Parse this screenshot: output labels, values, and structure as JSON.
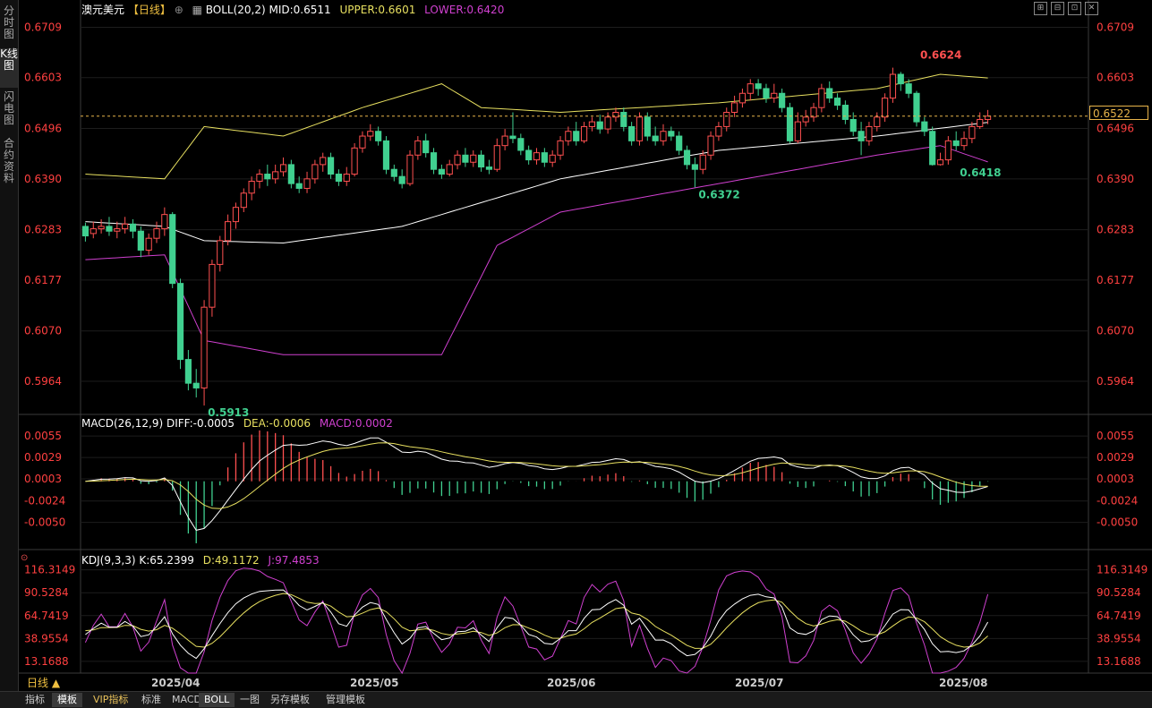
{
  "sidebar": {
    "items": [
      {
        "label": "分时图",
        "active": false
      },
      {
        "label": "K线图",
        "active": true
      },
      {
        "label": "闪电图",
        "active": false
      },
      {
        "label": "合约资料",
        "active": false
      }
    ]
  },
  "main_header": {
    "symbol": "澳元美元",
    "period": "【日线】",
    "boll_label": "BOLL(20,2)",
    "mid": "MID:0.6511",
    "upper": "UPPER:0.6601",
    "lower": "LOWER:0.6420"
  },
  "window_buttons": [
    "⊞",
    "⊟",
    "⊡",
    "✕"
  ],
  "price_axis_ticks": [
    "0.6709",
    "0.6603",
    "0.6496",
    "0.6390",
    "0.6283",
    "0.6177",
    "0.6070",
    "0.5964"
  ],
  "current_price": "0.6522",
  "annotations": {
    "high": "0.6624",
    "low": "0.5913",
    "mid_low": "0.6372",
    "recent_low": "0.6418"
  },
  "macd_header": {
    "label": "MACD(26,12,9)",
    "diff": "DIFF:-0.0005",
    "dea": "DEA:-0.0006",
    "macd": "MACD:0.0002"
  },
  "macd_ticks": [
    "0.0055",
    "0.0029",
    "0.0003",
    "-0.0024",
    "-0.0050"
  ],
  "kdj_header": {
    "label": "KDJ(9,3,3)",
    "k": "K:65.2399",
    "d": "D:49.1172",
    "j": "J:97.4853"
  },
  "kdj_ticks": [
    "116.3149",
    "90.5284",
    "64.7419",
    "38.9554",
    "13.1688"
  ],
  "date_labels": [
    "2025/04",
    "2025/05",
    "2025/06",
    "2025/07",
    "2025/08"
  ],
  "period_button": "日线 ▲",
  "bottom_tabs": [
    {
      "label": "指标",
      "active": false,
      "vip": false
    },
    {
      "label": "模板",
      "active": true,
      "vip": false
    },
    {
      "label": "VIP指标",
      "active": false,
      "vip": true
    },
    {
      "label": "标准",
      "active": false,
      "vip": false
    },
    {
      "label": "MACD",
      "active": false,
      "vip": false
    },
    {
      "label": "BOLL",
      "active": true,
      "vip": false
    },
    {
      "label": "一图",
      "active": false,
      "vip": false
    },
    {
      "label": "另存模板",
      "active": false,
      "vip": false
    },
    {
      "label": "管理模板",
      "active": false,
      "vip": false
    }
  ],
  "colors": {
    "up": "#ff5050",
    "down": "#40d090",
    "mid": "#ffffff",
    "upper": "#e8e060",
    "lower": "#d040d0",
    "axis_text": "#ff4040",
    "grid": "#333333",
    "current": "#e8b44a"
  },
  "chart_data": {
    "type": "candlestick",
    "price_range": [
      0.59,
      0.674
    ],
    "candles": [
      [
        0.629,
        0.627,
        0.6298,
        0.6258
      ],
      [
        0.6275,
        0.6285,
        0.63,
        0.6265
      ],
      [
        0.6285,
        0.629,
        0.6305,
        0.6275
      ],
      [
        0.629,
        0.628,
        0.631,
        0.627
      ],
      [
        0.628,
        0.6285,
        0.63,
        0.6265
      ],
      [
        0.6285,
        0.6295,
        0.631,
        0.6275
      ],
      [
        0.6295,
        0.628,
        0.6305,
        0.6265
      ],
      [
        0.628,
        0.624,
        0.629,
        0.6225
      ],
      [
        0.624,
        0.6265,
        0.6275,
        0.623
      ],
      [
        0.6265,
        0.6285,
        0.63,
        0.6255
      ],
      [
        0.6285,
        0.6315,
        0.633,
        0.627
      ],
      [
        0.6315,
        0.617,
        0.632,
        0.616
      ],
      [
        0.617,
        0.601,
        0.618,
        0.599
      ],
      [
        0.601,
        0.596,
        0.603,
        0.5945
      ],
      [
        0.596,
        0.595,
        0.599,
        0.593
      ],
      [
        0.595,
        0.612,
        0.6135,
        0.5913
      ],
      [
        0.612,
        0.621,
        0.622,
        0.61
      ],
      [
        0.621,
        0.626,
        0.627,
        0.6195
      ],
      [
        0.626,
        0.63,
        0.6315,
        0.625
      ],
      [
        0.63,
        0.633,
        0.634,
        0.6285
      ],
      [
        0.633,
        0.636,
        0.637,
        0.632
      ],
      [
        0.636,
        0.6385,
        0.6395,
        0.6345
      ],
      [
        0.6385,
        0.64,
        0.641,
        0.637
      ],
      [
        0.64,
        0.639,
        0.642,
        0.6375
      ],
      [
        0.639,
        0.6405,
        0.642,
        0.638
      ],
      [
        0.6405,
        0.642,
        0.6435,
        0.6395
      ],
      [
        0.642,
        0.638,
        0.643,
        0.637
      ],
      [
        0.638,
        0.637,
        0.6395,
        0.636
      ],
      [
        0.637,
        0.639,
        0.6405,
        0.636
      ],
      [
        0.639,
        0.642,
        0.643,
        0.638
      ],
      [
        0.642,
        0.6435,
        0.6445,
        0.6405
      ],
      [
        0.6435,
        0.64,
        0.6445,
        0.639
      ],
      [
        0.64,
        0.6385,
        0.641,
        0.6375
      ],
      [
        0.6385,
        0.64,
        0.6415,
        0.6375
      ],
      [
        0.64,
        0.6455,
        0.6465,
        0.6395
      ],
      [
        0.6455,
        0.648,
        0.649,
        0.6445
      ],
      [
        0.648,
        0.649,
        0.6505,
        0.647
      ],
      [
        0.649,
        0.647,
        0.65,
        0.646
      ],
      [
        0.647,
        0.641,
        0.648,
        0.64
      ],
      [
        0.641,
        0.6395,
        0.642,
        0.6385
      ],
      [
        0.6395,
        0.638,
        0.641,
        0.637
      ],
      [
        0.638,
        0.644,
        0.645,
        0.6375
      ],
      [
        0.644,
        0.647,
        0.648,
        0.643
      ],
      [
        0.647,
        0.6445,
        0.6485,
        0.6435
      ],
      [
        0.6445,
        0.641,
        0.6455,
        0.64
      ],
      [
        0.641,
        0.64,
        0.642,
        0.639
      ],
      [
        0.64,
        0.642,
        0.643,
        0.6395
      ],
      [
        0.642,
        0.644,
        0.645,
        0.641
      ],
      [
        0.644,
        0.6425,
        0.6455,
        0.6415
      ],
      [
        0.6425,
        0.644,
        0.645,
        0.6415
      ],
      [
        0.644,
        0.6415,
        0.645,
        0.6405
      ],
      [
        0.6415,
        0.641,
        0.643,
        0.64
      ],
      [
        0.641,
        0.646,
        0.6475,
        0.6405
      ],
      [
        0.646,
        0.648,
        0.6495,
        0.645
      ],
      [
        0.648,
        0.6475,
        0.653,
        0.6465
      ],
      [
        0.6475,
        0.645,
        0.6485,
        0.644
      ],
      [
        0.645,
        0.643,
        0.646,
        0.642
      ],
      [
        0.643,
        0.6445,
        0.6455,
        0.642
      ],
      [
        0.6445,
        0.6425,
        0.6455,
        0.6415
      ],
      [
        0.6425,
        0.644,
        0.645,
        0.6415
      ],
      [
        0.644,
        0.647,
        0.648,
        0.643
      ],
      [
        0.647,
        0.649,
        0.65,
        0.646
      ],
      [
        0.649,
        0.647,
        0.651,
        0.646
      ],
      [
        0.647,
        0.65,
        0.651,
        0.6465
      ],
      [
        0.65,
        0.651,
        0.652,
        0.649
      ],
      [
        0.651,
        0.6495,
        0.6525,
        0.6485
      ],
      [
        0.6495,
        0.652,
        0.653,
        0.6485
      ],
      [
        0.652,
        0.653,
        0.654,
        0.651
      ],
      [
        0.653,
        0.65,
        0.654,
        0.649
      ],
      [
        0.65,
        0.647,
        0.651,
        0.646
      ],
      [
        0.647,
        0.652,
        0.653,
        0.646
      ],
      [
        0.652,
        0.648,
        0.653,
        0.647
      ],
      [
        0.648,
        0.647,
        0.65,
        0.646
      ],
      [
        0.647,
        0.649,
        0.6505,
        0.646
      ],
      [
        0.649,
        0.648,
        0.65,
        0.647
      ],
      [
        0.648,
        0.645,
        0.649,
        0.644
      ],
      [
        0.645,
        0.642,
        0.646,
        0.641
      ],
      [
        0.642,
        0.641,
        0.6435,
        0.6372
      ],
      [
        0.641,
        0.644,
        0.645,
        0.64
      ],
      [
        0.644,
        0.648,
        0.649,
        0.643
      ],
      [
        0.648,
        0.65,
        0.651,
        0.647
      ],
      [
        0.65,
        0.653,
        0.654,
        0.649
      ],
      [
        0.653,
        0.655,
        0.6565,
        0.652
      ],
      [
        0.655,
        0.657,
        0.658,
        0.654
      ],
      [
        0.657,
        0.659,
        0.66,
        0.6555
      ],
      [
        0.659,
        0.658,
        0.66,
        0.6565
      ],
      [
        0.658,
        0.656,
        0.659,
        0.655
      ],
      [
        0.656,
        0.657,
        0.659,
        0.655
      ],
      [
        0.657,
        0.654,
        0.658,
        0.653
      ],
      [
        0.654,
        0.647,
        0.655,
        0.6465
      ],
      [
        0.647,
        0.651,
        0.653,
        0.6465
      ],
      [
        0.651,
        0.652,
        0.6535,
        0.65
      ],
      [
        0.652,
        0.654,
        0.655,
        0.651
      ],
      [
        0.654,
        0.658,
        0.659,
        0.653
      ],
      [
        0.658,
        0.656,
        0.6595,
        0.655
      ],
      [
        0.656,
        0.6545,
        0.657,
        0.6535
      ],
      [
        0.6545,
        0.6515,
        0.6555,
        0.6505
      ],
      [
        0.6515,
        0.649,
        0.653,
        0.648
      ],
      [
        0.649,
        0.647,
        0.651,
        0.644
      ],
      [
        0.647,
        0.65,
        0.651,
        0.646
      ],
      [
        0.65,
        0.652,
        0.653,
        0.649
      ],
      [
        0.652,
        0.656,
        0.657,
        0.651
      ],
      [
        0.656,
        0.661,
        0.6624,
        0.655
      ],
      [
        0.661,
        0.659,
        0.6615,
        0.6575
      ],
      [
        0.659,
        0.657,
        0.66,
        0.656
      ],
      [
        0.657,
        0.651,
        0.6575,
        0.65
      ],
      [
        0.651,
        0.649,
        0.652,
        0.648
      ],
      [
        0.649,
        0.642,
        0.65,
        0.6418
      ],
      [
        0.642,
        0.643,
        0.6445,
        0.6418
      ],
      [
        0.643,
        0.647,
        0.648,
        0.642
      ],
      [
        0.647,
        0.646,
        0.649,
        0.645
      ],
      [
        0.646,
        0.6475,
        0.649,
        0.645
      ],
      [
        0.6475,
        0.65,
        0.651,
        0.6465
      ],
      [
        0.65,
        0.6515,
        0.653,
        0.6495
      ],
      [
        0.6515,
        0.6522,
        0.6535,
        0.6505
      ]
    ],
    "boll_mid_anchor": [
      [
        0,
        0.63
      ],
      [
        10,
        0.629
      ],
      [
        15,
        0.626
      ],
      [
        25,
        0.6255
      ],
      [
        40,
        0.629
      ],
      [
        60,
        0.639
      ],
      [
        80,
        0.645
      ],
      [
        100,
        0.648
      ],
      [
        115,
        0.6511
      ]
    ],
    "boll_upper_anchor": [
      [
        0,
        0.64
      ],
      [
        10,
        0.639
      ],
      [
        15,
        0.65
      ],
      [
        25,
        0.648
      ],
      [
        35,
        0.654
      ],
      [
        45,
        0.659
      ],
      [
        50,
        0.654
      ],
      [
        60,
        0.653
      ],
      [
        80,
        0.655
      ],
      [
        100,
        0.658
      ],
      [
        108,
        0.661
      ],
      [
        115,
        0.6601
      ]
    ],
    "boll_lower_anchor": [
      [
        0,
        0.622
      ],
      [
        10,
        0.623
      ],
      [
        15,
        0.605
      ],
      [
        25,
        0.602
      ],
      [
        45,
        0.602
      ],
      [
        52,
        0.625
      ],
      [
        60,
        0.632
      ],
      [
        80,
        0.638
      ],
      [
        100,
        0.644
      ],
      [
        108,
        0.646
      ],
      [
        115,
        0.642
      ]
    ],
    "macd_range": [
      -0.007,
      0.0065
    ],
    "kdj_range": [
      0,
      125
    ]
  }
}
